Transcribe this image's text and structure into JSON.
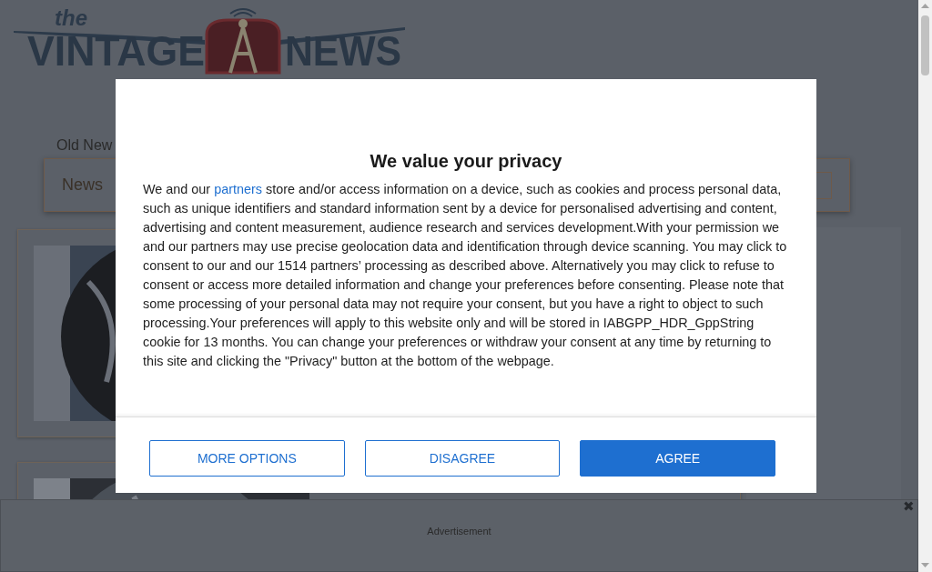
{
  "logo": {
    "small": "the",
    "left": "VINTAGE",
    "right": "NEWS"
  },
  "tagline": "Old New",
  "nav": {
    "items": [
      {
        "label": "News"
      }
    ]
  },
  "consent": {
    "title": "We value your privacy",
    "body_before": "We and our ",
    "link": "partners",
    "body_after": " store and/or access information on a device, such as cookies and process personal data, such as unique identifiers and standard information sent by a device for personalised advertising and content, advertising and content measurement, audience research and services development.With your permission we and our partners may use precise geolocation data and identification through device scanning. You may click to consent to our and our 1514 partners’ processing as described above. Alternatively you may click to refuse to consent or access more detailed information and change your preferences before consenting. Please note that some processing of your personal data may not require your consent, but you have a right to object to such processing.Your preferences will apply to this website only and will be stored in IABGPP_HDR_GppString cookie for 13 months. You can change your preferences or withdraw your consent at any time by returning to this site and clicking the \"Privacy\" button at the bottom of the webpage.",
    "buttons": [
      {
        "label": "MORE OPTIONS",
        "kind": "outline"
      },
      {
        "label": "DISAGREE",
        "kind": "outline"
      },
      {
        "label": "AGREE",
        "kind": "solid"
      }
    ]
  },
  "ad": {
    "label": "Advertisement",
    "close": "✖"
  }
}
